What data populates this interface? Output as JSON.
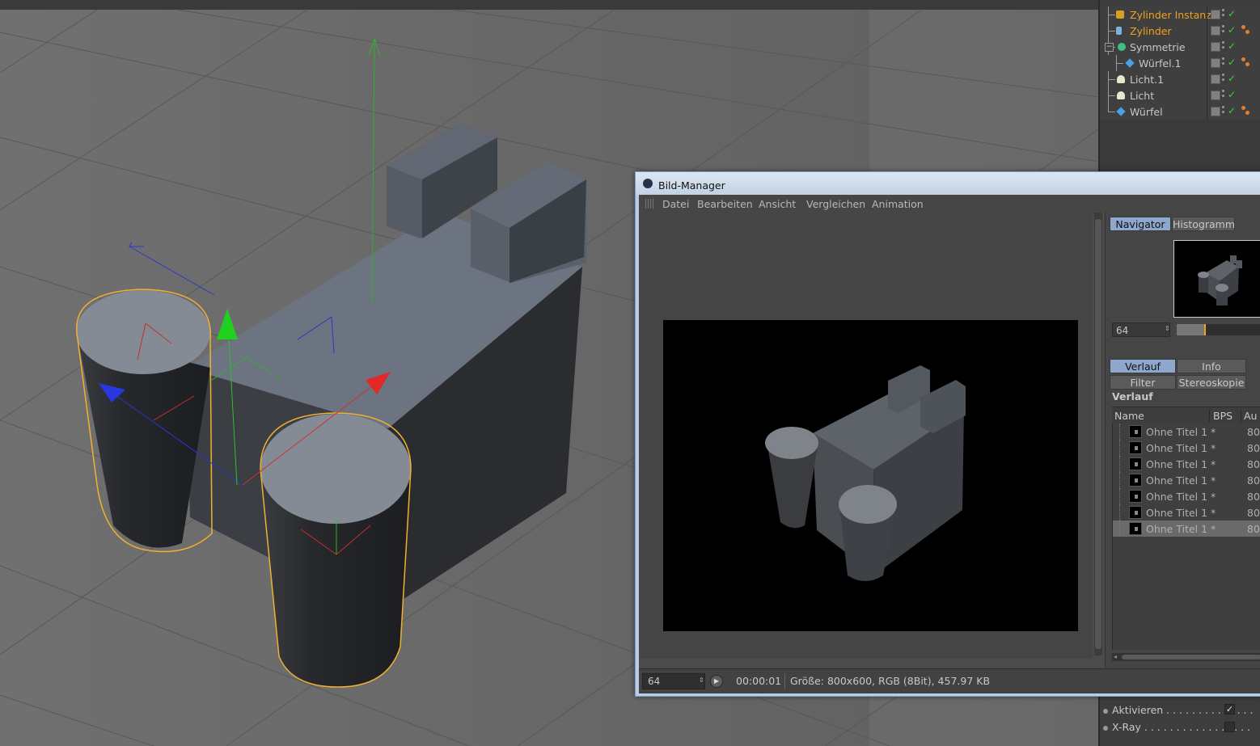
{
  "objects": [
    {
      "name": "Zylinder Instanz",
      "icon": "instance-icon",
      "selected": true
    },
    {
      "name": "Zylinder",
      "icon": "cylinder-icon",
      "selected": true
    },
    {
      "name": "Symmetrie",
      "icon": "symmetry-icon",
      "selected": false
    },
    {
      "name": "Würfel.1",
      "icon": "cube-icon",
      "selected": false
    },
    {
      "name": "Licht.1",
      "icon": "light-icon",
      "selected": false
    },
    {
      "name": "Licht",
      "icon": "light-icon",
      "selected": false
    },
    {
      "name": "Würfel",
      "icon": "cube-icon",
      "selected": false
    }
  ],
  "attributes": {
    "aktivieren": "Aktivieren . . . . . . . . . . . . . .",
    "aktivieren_check": "✓",
    "xray": "X-Ray . . . . . . . . . . . . . . . . ."
  },
  "bild_manager": {
    "title": "Bild-Manager",
    "menu": [
      "Datei",
      "Bearbeiten",
      "Ansicht",
      "Vergleichen",
      "Animation"
    ],
    "tabs_top": {
      "navigator": "Navigator",
      "histogramm": "Histogramm"
    },
    "zoom_value": "64",
    "zoom_fraction": 0.33,
    "tabs_mid": {
      "verlauf": "Verlauf",
      "info": "Info",
      "filter": "Filter",
      "stereoskopie": "Stereoskopie"
    },
    "section_title": "Verlauf",
    "columns": {
      "name": "Name",
      "bps": "BPS",
      "au": "Au"
    },
    "history": [
      {
        "name": "Ohne Titel 1 *",
        "bps": "80"
      },
      {
        "name": "Ohne Titel 1 *",
        "bps": "80"
      },
      {
        "name": "Ohne Titel 1 *",
        "bps": "80"
      },
      {
        "name": "Ohne Titel 1 *",
        "bps": "80"
      },
      {
        "name": "Ohne Titel 1 *",
        "bps": "80"
      },
      {
        "name": "Ohne Titel 1 *",
        "bps": "80"
      },
      {
        "name": "Ohne Titel 1 *",
        "bps": "80"
      }
    ],
    "status": {
      "frame": "64",
      "time": "00:00:01",
      "info": "Größe: 800x600, RGB (8Bit), 457.97 KB"
    }
  },
  "colors": {
    "selection": "#f0a020",
    "accent_tab": "#8ea7cc",
    "check": "#40d040"
  }
}
